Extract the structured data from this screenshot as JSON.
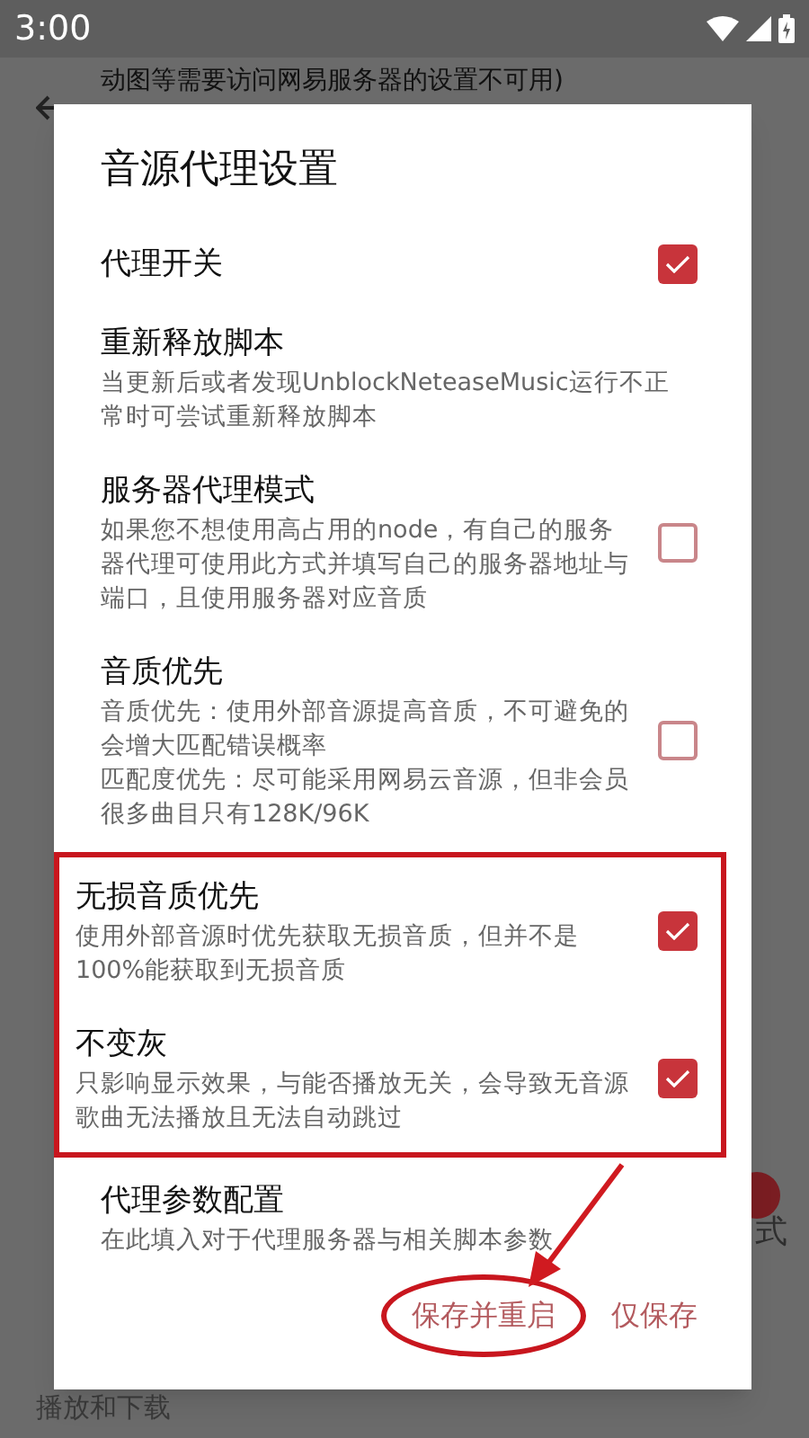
{
  "status_bar": {
    "time": "3:00"
  },
  "background": {
    "top_text": "动图等需要访问网易服务器的设置不可用)",
    "right_text": "式",
    "section_label": "播放和下载",
    "toggle_on": true
  },
  "dialog": {
    "title": "音源代理设置",
    "items": [
      {
        "title": "代理开关",
        "checkable": true,
        "checked": true,
        "boxed": false
      },
      {
        "title": "重新释放脚本",
        "description": "当更新后或者发现UnblockNeteaseMusic运行不正常时可尝试重新释放脚本",
        "checkable": false,
        "boxed": false
      },
      {
        "title": "服务器代理模式",
        "description": "如果您不想使用高占用的node，有自己的服务器代理可使用此方式并填写自己的服务器地址与端口，且使用服务器对应音质",
        "checkable": true,
        "checked": false,
        "boxed": false
      },
      {
        "title": "音质优先",
        "description": [
          "音质优先：使用外部音源提高音质，不可避免的会增大匹配错误概率",
          "匹配度优先：尽可能采用网易云音源，但非会员很多曲目只有128K/96K"
        ],
        "checkable": true,
        "checked": false,
        "boxed": false
      },
      {
        "title": "无损音质优先",
        "description": "使用外部音源时优先获取无损音质，但并不是100%能获取到无损音质",
        "checkable": true,
        "checked": true,
        "boxed": true
      },
      {
        "title": "不变灰",
        "description": "只影响显示效果，与能否播放无关，会导致无音源歌曲无法播放且无法自动跳过",
        "checkable": true,
        "checked": true,
        "boxed": true
      },
      {
        "title": "代理参数配置",
        "description": "在此填入对于代理服务器与相关脚本参数",
        "checkable": false,
        "boxed": false
      }
    ],
    "buttons": [
      {
        "label": "保存并重启",
        "circled": true
      },
      {
        "label": "仅保存",
        "circled": false
      }
    ]
  }
}
